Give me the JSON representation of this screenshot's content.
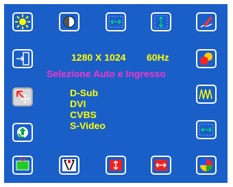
{
  "osd": {
    "resolution": "1280 X 1024",
    "refresh_rate": "60Hz",
    "section_title": "Selezione Auto e Ingresso",
    "inputs": [
      "D-Sub",
      "DVI",
      "CVBS",
      "S-Video"
    ]
  },
  "icons": {
    "brightness": "sun-icon",
    "contrast": "contrast-icon",
    "h_position": "horizontal-arrows-icon",
    "v_position": "vertical-arrows-icon",
    "sharpness": "pen-icon",
    "input": "enter-door-icon",
    "color": "color-dots-icon",
    "auto_input": "input-select-icon",
    "phase": "waveform-icon",
    "recall": "recycle-icon",
    "h_size": "horizontal-arrows-icon",
    "pip": "tv-icon",
    "tools": "tools-icon",
    "v_size": "vertical-resize-icon",
    "h_resize": "horizontal-resize-icon",
    "osd_color": "color-wheel-icon"
  },
  "colors": {
    "background": "#1a5ec8",
    "text_yellow": "#ffff00",
    "text_magenta": "#ff33cc",
    "border": "#ffffff"
  }
}
